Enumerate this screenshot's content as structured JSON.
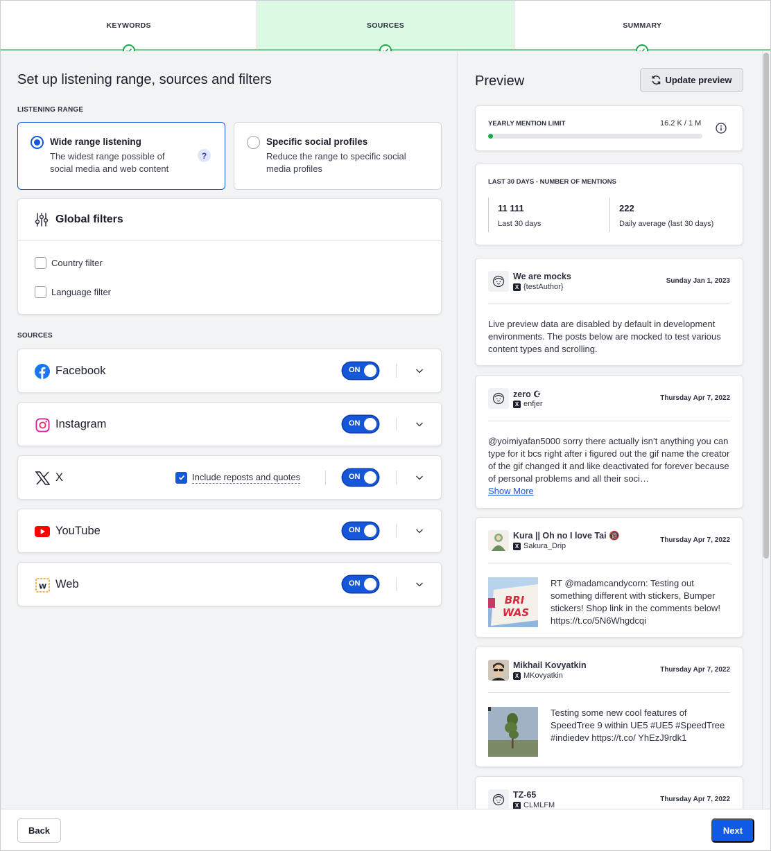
{
  "stepper": {
    "steps": [
      {
        "label": "KEYWORDS"
      },
      {
        "label": "SOURCES"
      },
      {
        "label": "SUMMARY"
      }
    ]
  },
  "setup": {
    "title": "Set up listening range, sources and filters",
    "range_label": "LISTENING RANGE",
    "wide": {
      "title": "Wide range listening",
      "desc": "The widest range possible of social media and web content",
      "help": "?"
    },
    "specific": {
      "title": "Specific social profiles",
      "desc": "Reduce the range to specific social media profiles"
    }
  },
  "filters": {
    "title": "Global filters",
    "country": "Country filter",
    "language": "Language filter"
  },
  "sources": {
    "label": "SOURCES",
    "items": [
      {
        "name": "Facebook",
        "toggle": "ON"
      },
      {
        "name": "Instagram",
        "toggle": "ON"
      },
      {
        "name": "X",
        "toggle": "ON",
        "option": "Include reposts and quotes"
      },
      {
        "name": "YouTube",
        "toggle": "ON"
      },
      {
        "name": "Web",
        "toggle": "ON"
      }
    ]
  },
  "preview": {
    "title": "Preview",
    "update_label": "Update preview",
    "limit": {
      "label": "YEARLY MENTION LIMIT",
      "value": "16.2 K / 1 M",
      "fraction": 0.0162
    },
    "mentions": {
      "title": "LAST 30 DAYS - NUMBER OF MENTIONS",
      "total": "11 111",
      "total_label": "Last 30 days",
      "avg": "222",
      "avg_label": "Daily average (last 30 days)"
    },
    "posts": [
      {
        "author": "We are mocks",
        "handle": "{testAuthor}",
        "date": "Sunday Jan 1, 2023",
        "text": "Live preview data are disabled by default in development environments. The posts below are mocked to test various content types and scrolling."
      },
      {
        "author": "zero ☪︎",
        "handle": "enfjer",
        "date": "Thursday Apr 7, 2022",
        "text": "@yoimiyafan5000 sorry there actually isn’t anything you can type for it bcs right after i figured out the gif name the creator of the gif changed it and like deactivated for forever because of personal problems and all their soci…",
        "more": "Show More"
      },
      {
        "author": "Kura || Oh no I love Tai 🔞",
        "handle": "Sakura_Drip",
        "date": "Thursday Apr 7, 2022",
        "text": "RT @madamcandycorn: Testing out something different with stickers, Bumper stickers! Shop link in the comments below! https://t.co/5N6Whgdcqi"
      },
      {
        "author": "Mikhail Kovyatkin",
        "handle": "MKovyatkin",
        "date": "Thursday Apr 7, 2022",
        "text": "Testing some new cool features of SpeedTree 9 within UE5 #UE5 #SpeedTree #indiedev https://t.co/ YhEzJ9rdk1"
      },
      {
        "author": "TZ-65",
        "handle": "CLMLFM",
        "date": "Thursday Apr 7, 2022"
      }
    ]
  },
  "footer": {
    "back": "Back",
    "next": "Next"
  },
  "colors": {
    "accent": "#1457d9",
    "success": "#17a94a",
    "active_step": "#dcfae3"
  }
}
